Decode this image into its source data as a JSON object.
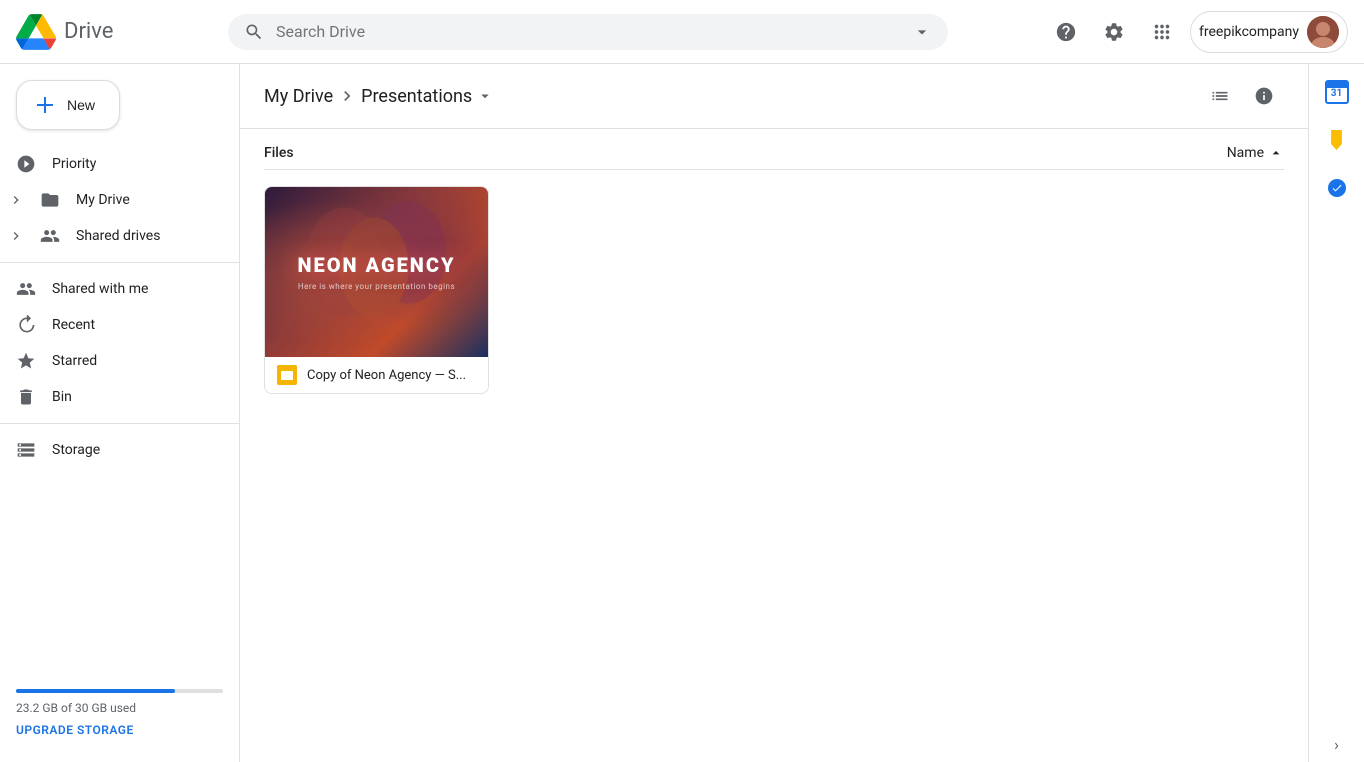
{
  "app": {
    "name": "Drive",
    "logo_alt": "Google Drive"
  },
  "header": {
    "search_placeholder": "Search Drive",
    "help_icon": "help-circle",
    "settings_icon": "gear",
    "apps_icon": "grid",
    "account_name": "freepikcompany"
  },
  "sidebar": {
    "new_button_label": "New",
    "items": [
      {
        "id": "priority",
        "label": "Priority",
        "icon": "check-circle"
      },
      {
        "id": "my-drive",
        "label": "My Drive",
        "icon": "folder",
        "has_expand": true
      },
      {
        "id": "shared-drives",
        "label": "Shared drives",
        "icon": "people",
        "has_expand": true
      },
      {
        "id": "shared-with-me",
        "label": "Shared with me",
        "icon": "person"
      },
      {
        "id": "recent",
        "label": "Recent",
        "icon": "clock"
      },
      {
        "id": "starred",
        "label": "Starred",
        "icon": "star"
      },
      {
        "id": "bin",
        "label": "Bin",
        "icon": "trash"
      }
    ],
    "storage": {
      "label": "Storage",
      "used_text": "23.2 GB of 30 GB used",
      "upgrade_label": "UPGRADE STORAGE",
      "percent": 77
    }
  },
  "breadcrumb": {
    "parent": "My Drive",
    "current": "Presentations"
  },
  "content": {
    "section_title": "Files",
    "sort_label": "Name",
    "files": [
      {
        "id": "neon-agency",
        "name": "Copy of Neon Agency — S...",
        "thumbnail_title": "NEON AGENCY",
        "thumbnail_subtitle": "Here is where your presentation begins",
        "type": "slides"
      }
    ]
  },
  "right_panel": {
    "calendar_date": "31",
    "chevron_label": "›"
  }
}
